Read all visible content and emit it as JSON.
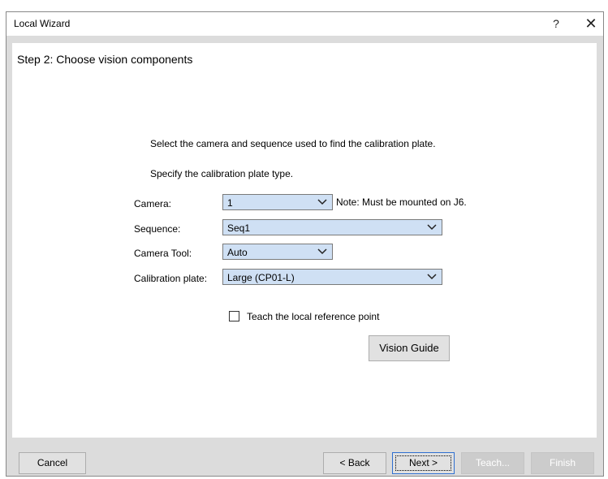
{
  "window": {
    "title": "Local Wizard",
    "help_label": "?",
    "close_label": "✕"
  },
  "step": {
    "title": "Step 2: Choose vision components",
    "instruction_1": "Select the camera and sequence used to find the calibration plate.",
    "instruction_2": "Specify the calibration plate type."
  },
  "fields": {
    "camera": {
      "label": "Camera:",
      "value": "1",
      "note": "Note: Must be mounted on J6."
    },
    "sequence": {
      "label": "Sequence:",
      "value": "Seq1"
    },
    "camera_tool": {
      "label": "Camera Tool:",
      "value": "Auto"
    },
    "calibration_plate": {
      "label": "Calibration plate:",
      "value": "Large (CP01-L)"
    }
  },
  "teach_checkbox": {
    "label": "Teach the local reference point",
    "checked": false
  },
  "vision_guide_button": "Vision Guide",
  "footer": {
    "cancel": "Cancel",
    "back": "< Back",
    "next": "Next >",
    "teach": "Teach...",
    "finish": "Finish"
  },
  "colors": {
    "combo_bg": "#cfe0f4",
    "dialog_bg": "#dcdcdc",
    "panel_bg": "#ffffff",
    "next_border": "#2f6fd0"
  }
}
